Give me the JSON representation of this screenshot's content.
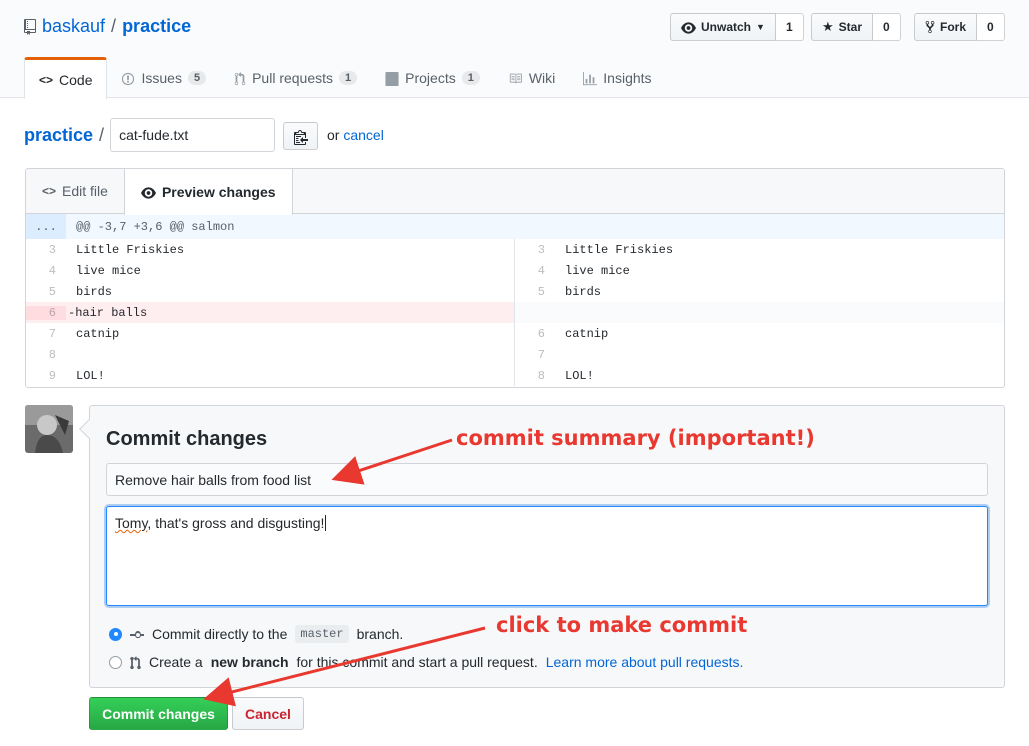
{
  "repo": {
    "owner": "baskauf",
    "separator": "/",
    "name": "practice"
  },
  "actions": {
    "watch_label": "Unwatch",
    "watch_count": "1",
    "star_label": "Star",
    "star_count": "0",
    "fork_label": "Fork",
    "fork_count": "0"
  },
  "tabs": [
    {
      "label": "Code",
      "count": null,
      "selected": true
    },
    {
      "label": "Issues",
      "count": "5"
    },
    {
      "label": "Pull requests",
      "count": "1"
    },
    {
      "label": "Projects",
      "count": "1"
    },
    {
      "label": "Wiki",
      "count": null
    },
    {
      "label": "Insights",
      "count": null
    }
  ],
  "breadcrumb": {
    "root": "practice",
    "slash": "/",
    "filename": "cat-fude.txt",
    "or": "or",
    "cancel": "cancel"
  },
  "editor": {
    "tab_edit": "Edit file",
    "tab_preview": "Preview changes",
    "hunk_expand": "...",
    "hunk_header": "@@ -3,7 +3,6 @@ salmon",
    "left": [
      {
        "ln": "3",
        "code": "Little Friskies"
      },
      {
        "ln": "4",
        "code": "live mice"
      },
      {
        "ln": "5",
        "code": "birds"
      },
      {
        "ln": "6",
        "code": "-hair balls"
      },
      {
        "ln": "7",
        "code": "catnip"
      },
      {
        "ln": "8",
        "code": ""
      },
      {
        "ln": "9",
        "code": "LOL!"
      }
    ],
    "right": [
      {
        "ln": "3",
        "code": "Little Friskies"
      },
      {
        "ln": "4",
        "code": "live mice"
      },
      {
        "ln": "5",
        "code": "birds"
      },
      {
        "ln": "",
        "code": ""
      },
      {
        "ln": "6",
        "code": "catnip"
      },
      {
        "ln": "7",
        "code": ""
      },
      {
        "ln": "8",
        "code": "LOL!"
      }
    ]
  },
  "commit": {
    "title": "Commit changes",
    "summary_value": "Remove hair balls from food list",
    "description_first": "Tomy",
    "description_rest": ", that's gross and disgusting!",
    "option_direct_prefix": "Commit directly to the",
    "option_direct_branch": "master",
    "option_direct_suffix": "branch.",
    "option_new_prefix": "Create a",
    "option_new_bold": "new branch",
    "option_new_suffix": "for this commit and start a pull request.",
    "option_new_link": "Learn more about pull requests.",
    "submit_label": "Commit changes",
    "cancel_label": "Cancel"
  },
  "annotations": {
    "summary": "commit summary (important!)",
    "click": "click to make commit",
    "color": "#e8382f"
  },
  "colors": {
    "link": "#0366d6",
    "green": "#28a745",
    "tab_accent": "#e36209",
    "cancel_red": "#cb2431"
  }
}
